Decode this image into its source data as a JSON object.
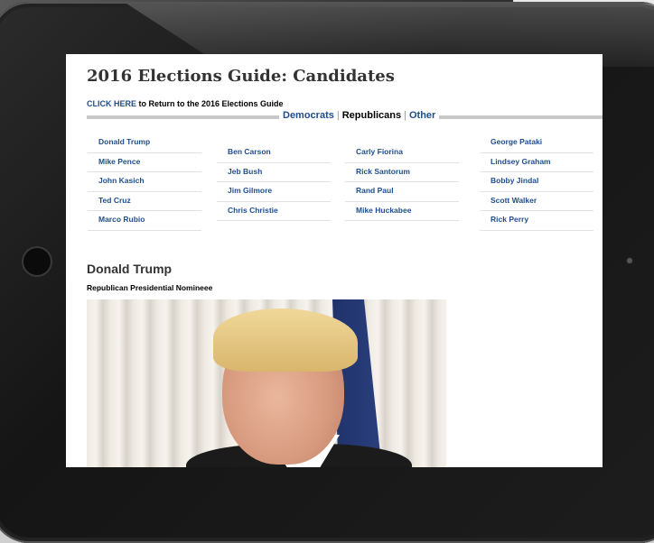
{
  "page": {
    "title": "2016 Elections Guide: Candidates",
    "back_link": "CLICK HERE",
    "back_text": " to Return to the 2016 Elections Guide"
  },
  "tabs": {
    "democrats": "Democrats",
    "republicans": "Republicans",
    "other": "Other",
    "separator": "|"
  },
  "candidates": {
    "col1": [
      "Donald Trump",
      "Mike Pence",
      "John Kasich",
      "Ted Cruz",
      "Marco Rubio"
    ],
    "col2": [
      "Ben Carson",
      "Jeb Bush",
      "Jim Gilmore",
      "Chris Christie"
    ],
    "col3": [
      "Carly Fiorina",
      "Rick Santorum",
      "Rand Paul",
      "Mike Huckabee"
    ],
    "col4": [
      "George Pataki",
      "Lindsey Graham",
      "Bobby Jindal",
      "Scott Walker",
      "Rick Perry"
    ]
  },
  "profile": {
    "name": "Donald Trump",
    "subtitle": "Republican Presidential Nomineee"
  },
  "icons": {
    "home": "home-button-icon",
    "camera": "camera-icon"
  }
}
